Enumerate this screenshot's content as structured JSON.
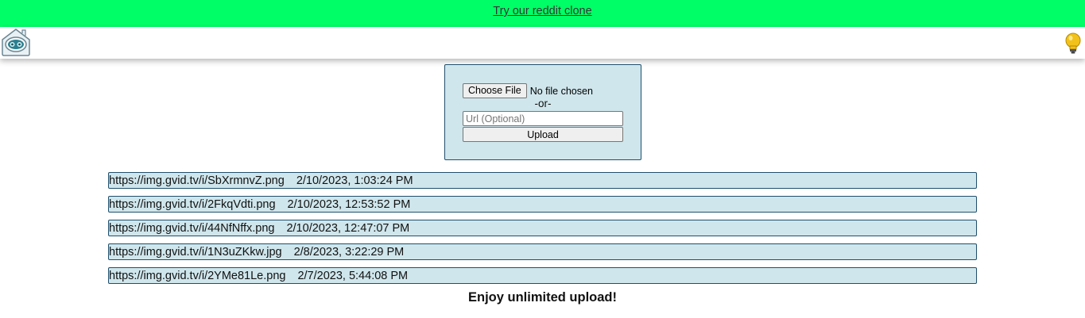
{
  "banner": {
    "link_text": "Try our reddit clone"
  },
  "navbar": {
    "logo_icon": "robot-house-logo",
    "theme_icon": "lightbulb-icon"
  },
  "upload_form": {
    "choose_file_label": "Choose File",
    "file_status": "No file chosen",
    "or_label": "-or-",
    "url_placeholder": "Url (Optional)",
    "url_value": "",
    "upload_label": "Upload"
  },
  "uploads": [
    {
      "url": "https://img.gvid.tv/i/SbXrmnvZ.png",
      "time": "2/10/2023, 1:03:24 PM"
    },
    {
      "url": "https://img.gvid.tv/i/2FkqVdti.png",
      "time": "2/10/2023, 12:53:52 PM"
    },
    {
      "url": "https://img.gvid.tv/i/44NfNffx.png",
      "time": "2/10/2023, 12:47:07 PM"
    },
    {
      "url": "https://img.gvid.tv/i/1N3uZKkw.jpg",
      "time": "2/8/2023, 3:22:29 PM"
    },
    {
      "url": "https://img.gvid.tv/i/2YMe81Le.png",
      "time": "2/7/2023, 5:44:08 PM"
    }
  ],
  "footer": {
    "message": "Enjoy unlimited upload!"
  },
  "colors": {
    "banner_bg": "#00ff66",
    "panel_bg": "#cfe6ec",
    "panel_border": "#1f4f6d",
    "bulb": "#f2c21b"
  }
}
